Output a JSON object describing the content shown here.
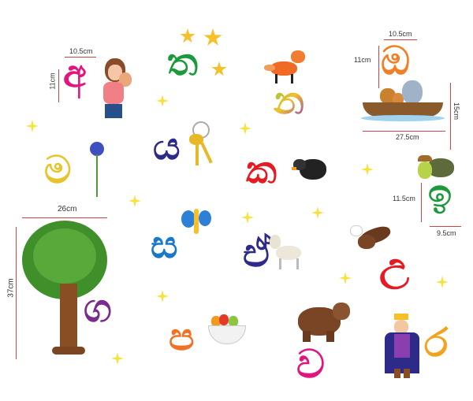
{
  "letters": [
    {
      "char": "අ",
      "color": "#e0157f"
    },
    {
      "char": "ත",
      "color": "#1b9a3b"
    },
    {
      "char": "න",
      "color": "#8a3fb0"
    },
    {
      "char": "ඔ",
      "color": "#f07f25"
    },
    {
      "char": "ය",
      "color": "#2e2a8a"
    },
    {
      "char": "ම",
      "color": "#e8c32a"
    },
    {
      "char": "ක",
      "color": "#e31b23"
    },
    {
      "char": "ඉ",
      "color": "#1b9a3b"
    },
    {
      "char": "ස",
      "color": "#1a78c8"
    },
    {
      "char": "ඒ",
      "color": "#2e2a8a"
    },
    {
      "char": "උ",
      "color": "#e31b23"
    },
    {
      "char": "ග",
      "color": "#7a2c8e"
    },
    {
      "char": "ප",
      "color": "#f07325"
    },
    {
      "char": "ව",
      "color": "#e0157f"
    },
    {
      "char": "ර",
      "color": "#f3a21d"
    }
  ],
  "dimensions": {
    "mother_width": "10.5cm",
    "mother_height": "11cm",
    "o_width": "10.5cm",
    "o_height": "11cm",
    "boat_height": "15cm",
    "boat_width": "27.5cm",
    "turtle_height": "11.5cm",
    "turtle_width": "9.5cm",
    "tree_width": "26cm",
    "tree_height": "37cm"
  }
}
